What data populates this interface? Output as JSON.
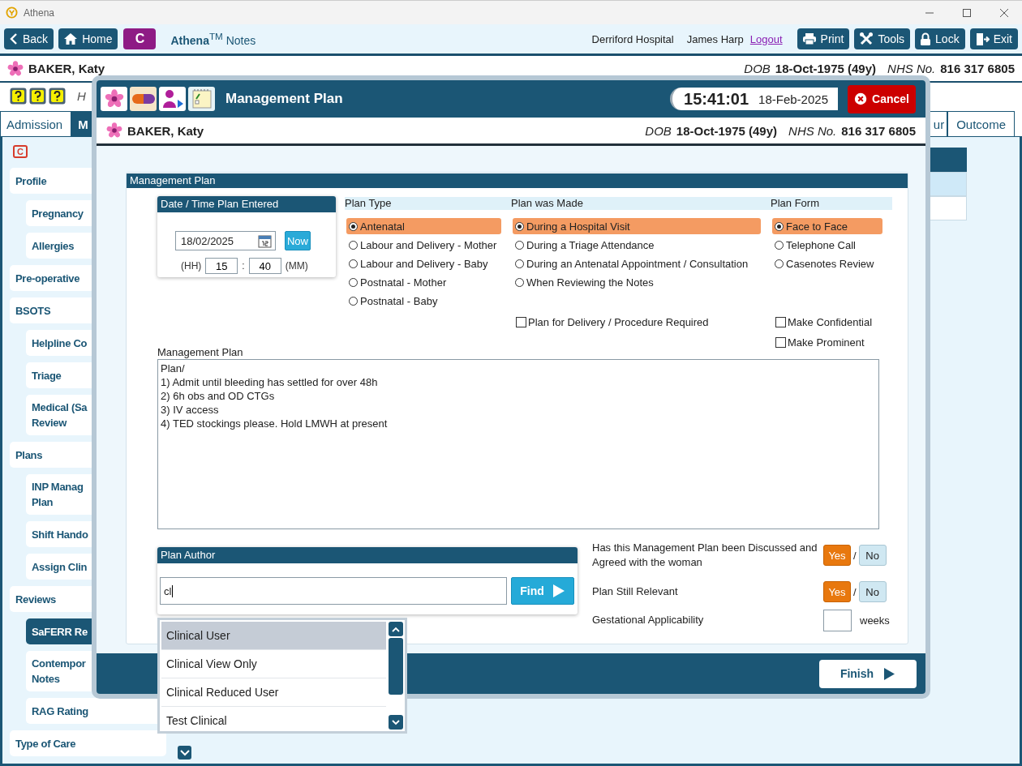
{
  "window": {
    "title": "Athena"
  },
  "toolbar": {
    "nav": [
      "Back",
      "Home"
    ],
    "app_button": "C",
    "app_name": "**Athena**$^{TM}$ Notes",
    "hospital": "Derriford Hospital",
    "user": "James Harp",
    "logout": "Logout",
    "actions": [
      "Print",
      "Tools",
      "Lock",
      "Exit"
    ]
  },
  "patient": {
    "name": "BAKER, Katy",
    "dob_label": "DOB",
    "dob": "18-Oct-1975 (49y)",
    "nhs_label": "NHS No.",
    "nhs": "816 317 6805"
  },
  "subheader": {
    "text": "H"
  },
  "tabs": [
    {
      "label": "Admission",
      "selected": false
    },
    {
      "label": "M",
      "selected": true
    },
    {
      "label": "ur",
      "selected": false
    },
    {
      "label": "Outcome",
      "selected": false
    }
  ],
  "sidebar": {
    "badge": "C",
    "items": [
      {
        "label": "Profile",
        "selected": false,
        "children": [
          {
            "label": "Pregnancy",
            "selected": false
          },
          {
            "label": "Allergies",
            "selected": false
          }
        ]
      },
      {
        "label": "Pre-operative",
        "selected": false
      },
      {
        "label": "BSOTS",
        "selected": false,
        "children": [
          {
            "label": "Helpline Co",
            "selected": false
          },
          {
            "label": "Triage",
            "selected": false
          },
          {
            "label": "Medical (Sa\nReview",
            "selected": false
          }
        ]
      },
      {
        "label": "Plans",
        "selected": false,
        "children": [
          {
            "label": "INP Manag\nPlan",
            "selected": false
          },
          {
            "label": "Shift Hando",
            "selected": false
          },
          {
            "label": "Assign Clin",
            "selected": false
          }
        ]
      },
      {
        "label": "Reviews",
        "selected": false,
        "children": [
          {
            "label": "SaFERR Re",
            "selected": true
          },
          {
            "label": "Contempor\nNotes",
            "selected": false
          },
          {
            "label": "RAG Rating",
            "selected": false
          }
        ]
      },
      {
        "label": "Type of Care",
        "selected": false
      }
    ]
  },
  "dialog": {
    "title": "Management Plan",
    "time": "15:41:01",
    "date": "18-Feb-2025",
    "cancel": "Cancel",
    "patient": {
      "name": "BAKER, Katy",
      "dob_label": "DOB",
      "dob": "18-Oct-1975 (49y)",
      "nhs_label": "NHS No.",
      "nhs": "816 317 6805"
    },
    "section_title": "Management Plan",
    "date_box": {
      "title": "Date / Time Plan Entered",
      "date": "18/02/2025",
      "now": "Now",
      "hh_label": "(HH)",
      "hh": "15",
      "separator": ":",
      "mm": "40",
      "mm_label": "(MM)"
    },
    "groups": [
      {
        "title": "Plan Type",
        "options": [
          {
            "label": "Antenatal",
            "selected": true
          },
          {
            "label": "Labour and Delivery - Mother",
            "selected": false
          },
          {
            "label": "Labour and Delivery - Baby",
            "selected": false
          },
          {
            "label": "Postnatal - Mother",
            "selected": false
          },
          {
            "label": "Postnatal - Baby",
            "selected": false
          }
        ]
      },
      {
        "title": "Plan was Made",
        "options": [
          {
            "label": "During a Hospital Visit",
            "selected": true
          },
          {
            "label": "During a Triage Attendance",
            "selected": false
          },
          {
            "label": "During an Antenatal Appointment / Consultation",
            "selected": false
          },
          {
            "label": "When Reviewing the Notes",
            "selected": false
          }
        ],
        "checkboxes": [
          {
            "label": "Plan for Delivery / Procedure Required",
            "checked": false
          }
        ]
      },
      {
        "title": "Plan Form",
        "options": [
          {
            "label": "Face to Face",
            "selected": true
          },
          {
            "label": "Telephone Call",
            "selected": false
          },
          {
            "label": "Casenotes Review",
            "selected": false
          }
        ],
        "checkboxes": [
          {
            "label": "Make Confidential",
            "checked": false
          },
          {
            "label": "Make Prominent",
            "checked": false
          }
        ]
      }
    ],
    "notes": {
      "label": "Management Plan",
      "value": "Plan/\n1) Admit until bleeding has settled for over 48h\n2) 6h obs and OD CTGs\n3) IV access\n4) TED stockings please. Hold LMWH at present"
    },
    "author": {
      "title": "Plan Author",
      "value": "cl",
      "find": "Find",
      "suggestions": [
        {
          "label": "Clinical User",
          "selected": true
        },
        {
          "label": "Clinical View Only",
          "selected": false
        },
        {
          "label": "Clinical Reduced User",
          "selected": false
        },
        {
          "label": "Test Clinical",
          "selected": false
        }
      ]
    },
    "questions": [
      {
        "kind": "yesno",
        "label": "Has this Management Plan been Discussed and Agreed with the woman",
        "separator": "/",
        "options": [
          {
            "label": "Yes",
            "selected": true
          },
          {
            "label": "No",
            "selected": false
          }
        ]
      },
      {
        "kind": "yesno",
        "label": "Plan Still Relevant",
        "separator": "/",
        "options": [
          {
            "label": "Yes",
            "selected": true
          },
          {
            "label": "No",
            "selected": false
          }
        ]
      },
      {
        "kind": "number",
        "label": "Gestational Applicability",
        "unit": "weeks"
      }
    ],
    "finish": "Finish"
  }
}
